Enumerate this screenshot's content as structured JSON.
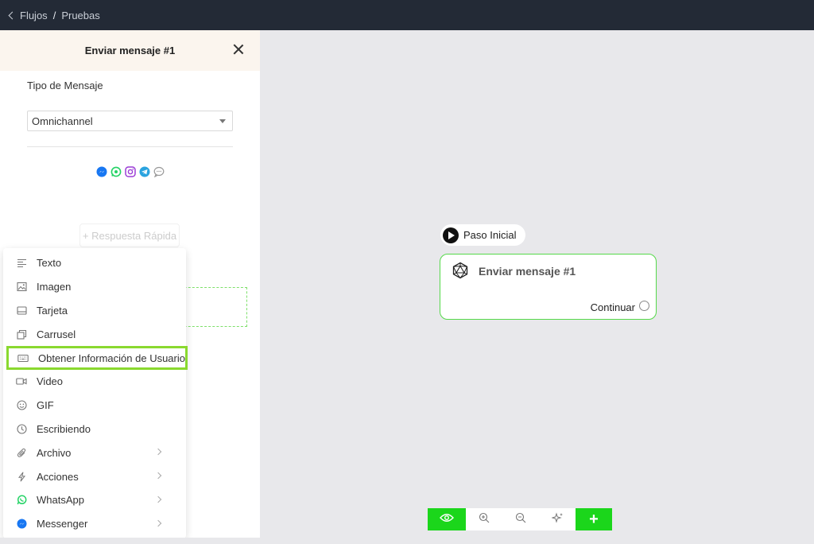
{
  "breadcrumb": {
    "root": "Flujos",
    "separator": "/",
    "current": "Pruebas"
  },
  "panel": {
    "title": "Enviar mensaje #1",
    "field_label": "Tipo de Mensaje",
    "select_value": "Omnichannel",
    "channels": [
      "messenger-icon",
      "whatsapp-icon",
      "instagram-icon",
      "telegram-icon",
      "chat-icon"
    ],
    "quick_reply": "+ Respuesta Rápida"
  },
  "menu": {
    "items": [
      {
        "label": "Texto",
        "icon": "text-icon",
        "submenu": false
      },
      {
        "label": "Imagen",
        "icon": "image-icon",
        "submenu": false
      },
      {
        "label": "Tarjeta",
        "icon": "card-icon",
        "submenu": false
      },
      {
        "label": "Carrusel",
        "icon": "carousel-icon",
        "submenu": false
      },
      {
        "label": "Obtener Información de Usuario",
        "icon": "keyboard-icon",
        "submenu": false,
        "highlighted": true
      },
      {
        "label": "Video",
        "icon": "video-icon",
        "submenu": false
      },
      {
        "label": "GIF",
        "icon": "gif-icon",
        "submenu": false
      },
      {
        "label": "Escribiendo",
        "icon": "clock-icon",
        "submenu": false
      },
      {
        "label": "Archivo",
        "icon": "paperclip-icon",
        "submenu": true
      },
      {
        "label": "Acciones",
        "icon": "lightning-icon",
        "submenu": true
      },
      {
        "label": "WhatsApp",
        "icon": "whatsapp-icon",
        "submenu": true
      },
      {
        "label": "Messenger",
        "icon": "messenger-icon",
        "submenu": true
      }
    ]
  },
  "canvas": {
    "start_label": "Paso Inicial",
    "node_title": "Enviar mensaje #1",
    "node_continue": "Continuar"
  },
  "toolbar": {
    "buttons": [
      "eye-icon",
      "zoom-in-icon",
      "zoom-out-icon",
      "magic-icon",
      "plus-icon"
    ],
    "plus_label": "+"
  },
  "colors": {
    "accent_green": "#1bd61b",
    "highlight_green": "#8ad92f",
    "topbar": "#232a36",
    "panel_header": "#fbf5ee",
    "canvas": "#e8e8eb"
  }
}
